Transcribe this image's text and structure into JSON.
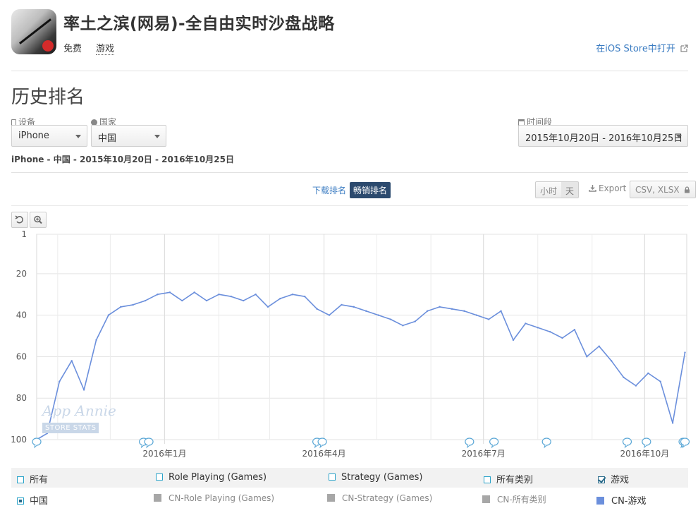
{
  "app": {
    "title": "率土之滨(网易)-全自由实时沙盘战略",
    "price": "免费",
    "category": "游戏",
    "open_store": "在iOS Store中打开"
  },
  "page": {
    "section_title": "历史排名"
  },
  "filters": {
    "device_label": "设备",
    "device_value": "iPhone",
    "country_label": "国家",
    "country_value": "中国",
    "period_label": "时间段",
    "period_value": "2015年10月20日 - 2016年10月25日"
  },
  "summary": "iPhone - 中国 - 2015年10月20日 - 2016年10月25日",
  "toolbar": {
    "download_rank": "下载排名",
    "grossing_rank": "畅销排名",
    "hour": "小时",
    "day": "天",
    "export": "Export",
    "csv": "CSV, XLSX"
  },
  "watermark": {
    "brand": "App Annie",
    "sub": "STORE STATS"
  },
  "legend": {
    "row1": [
      {
        "label": "所有",
        "checked": false
      },
      {
        "label": "Role Playing (Games)",
        "checked": false
      },
      {
        "label": "Strategy (Games)",
        "checked": false
      },
      {
        "label": "所有类别",
        "checked": false
      },
      {
        "label": "游戏",
        "checked": true
      }
    ],
    "row2": [
      {
        "label": "中国",
        "active": true
      },
      {
        "label": "CN-Role Playing (Games)",
        "active": false
      },
      {
        "label": "CN-Strategy (Games)",
        "active": false
      },
      {
        "label": "CN-所有类别",
        "active": false
      },
      {
        "label": "CN-游戏",
        "active": true
      }
    ]
  },
  "colors": {
    "line": "#6b8fdc",
    "accent": "#2c4a6e",
    "link": "#3b7cc2"
  },
  "chart_data": {
    "type": "line",
    "y_reversed": true,
    "ylim": [
      1,
      100
    ],
    "yticks": [
      1,
      20,
      40,
      60,
      80,
      100
    ],
    "xlim": [
      "2015-10-20",
      "2016-10-25"
    ],
    "xtick_labels": [
      {
        "date": "2016-01-01",
        "label": "2016年1月"
      },
      {
        "date": "2016-04-01",
        "label": "2016年4月"
      },
      {
        "date": "2016-07-01",
        "label": "2016年7月"
      },
      {
        "date": "2016-10-01",
        "label": "2016年10月"
      }
    ],
    "grid": true,
    "series": [
      {
        "name": "CN-游戏",
        "x": [
          "2015-10-20",
          "2015-10-26",
          "2015-11-02",
          "2015-11-09",
          "2015-11-16",
          "2015-11-23",
          "2015-11-30",
          "2015-12-07",
          "2015-12-14",
          "2015-12-21",
          "2015-12-28",
          "2016-01-04",
          "2016-01-11",
          "2016-01-18",
          "2016-01-25",
          "2016-02-01",
          "2016-02-08",
          "2016-02-15",
          "2016-02-22",
          "2016-02-29",
          "2016-03-07",
          "2016-03-14",
          "2016-03-21",
          "2016-03-28",
          "2016-04-04",
          "2016-04-11",
          "2016-04-18",
          "2016-04-25",
          "2016-05-02",
          "2016-05-09",
          "2016-05-16",
          "2016-05-23",
          "2016-05-30",
          "2016-06-06",
          "2016-06-13",
          "2016-06-20",
          "2016-06-27",
          "2016-07-04",
          "2016-07-11",
          "2016-07-18",
          "2016-07-25",
          "2016-08-01",
          "2016-08-08",
          "2016-08-15",
          "2016-08-22",
          "2016-08-29",
          "2016-09-05",
          "2016-09-12",
          "2016-09-19",
          "2016-09-26",
          "2016-10-03",
          "2016-10-10",
          "2016-10-17",
          "2016-10-24"
        ],
        "values": [
          100,
          97,
          72,
          62,
          76,
          52,
          40,
          36,
          35,
          33,
          30,
          29,
          33,
          29,
          33,
          30,
          31,
          33,
          30,
          36,
          32,
          30,
          31,
          37,
          40,
          35,
          36,
          38,
          40,
          42,
          45,
          43,
          38,
          36,
          37,
          38,
          40,
          42,
          38,
          52,
          44,
          46,
          48,
          51,
          47,
          60,
          55,
          62,
          70,
          74,
          68,
          72,
          92,
          58
        ]
      }
    ],
    "markers": [
      "2015-10-20",
      "2015-12-20",
      "2015-12-23",
      "2016-03-28",
      "2016-03-31",
      "2016-06-23",
      "2016-07-07",
      "2016-08-06",
      "2016-09-21",
      "2016-10-02",
      "2016-10-23",
      "2016-10-24"
    ]
  }
}
